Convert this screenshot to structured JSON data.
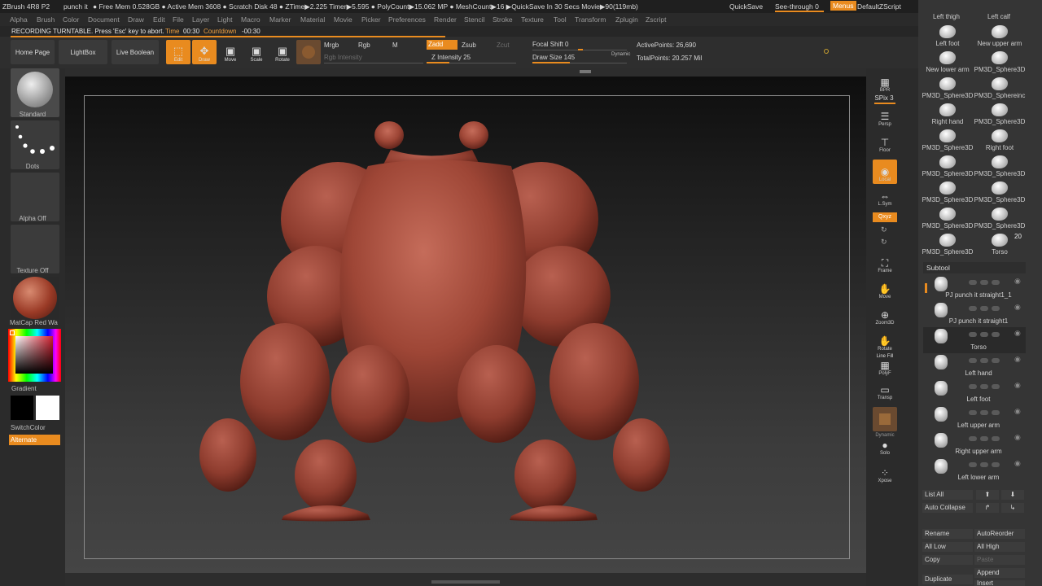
{
  "titlebar": {
    "items": [
      "ZBrush 4R8 P2",
      "punch it",
      "● Free Mem 0.528GB ● Active Mem 3608 ● Scratch Disk 48 ● ZTime▶2.225 Timer▶5.595 ● PolyCount▶15.062 MP ● MeshCount▶16 ▶QuickSave In 30 Secs Movie▶90(119mb)"
    ],
    "quicksave": "QuickSave",
    "seethrough": "See-through  0",
    "menus": "Menus",
    "script": "DefaultZScript"
  },
  "menubar": [
    "Alpha",
    "Brush",
    "Color",
    "Document",
    "Draw",
    "Edit",
    "File",
    "Layer",
    "Light",
    "Macro",
    "Marker",
    "Material",
    "Movie",
    "Picker",
    "Preferences",
    "Render",
    "Stencil",
    "Stroke",
    "Texture",
    "Tool",
    "Transform",
    "Zplugin",
    "Zscript"
  ],
  "recording": {
    "message": "RECORDING TURNTABLE. Press 'Esc' key to abort.",
    "time_label": "Time",
    "time_value": "00:30",
    "countdown_label": "Countdown",
    "countdown_value": "-00:30",
    "progress": 0.52
  },
  "toolbar": {
    "home_page": "Home Page",
    "lightbox": "LightBox",
    "live_boolean": "Live Boolean",
    "edit": "Edit",
    "draw": "Draw",
    "move": "Move",
    "scale": "Scale",
    "rotate": "Rotate",
    "mrgb": "Mrgb",
    "rgb": "Rgb",
    "m": "M",
    "rgb_intensity": "Rgb Intensity",
    "zadd": "Zadd",
    "zsub": "Zsub",
    "zcut": "Zcut",
    "z_intensity": "Z Intensity 25",
    "z_intensity_value": 25,
    "focal_shift": "Focal Shift 0",
    "draw_size": "Draw Size 145",
    "dynamic": "Dynamic",
    "active_points": "ActivePoints: 26,690",
    "total_points": "TotalPoints: 20.257 Mil"
  },
  "leftshelf": {
    "brush": "Standard",
    "stroke": "Dots",
    "alpha": "Alpha Off",
    "texture": "Texture Off",
    "material": "MatCap Red Wa",
    "gradient": "Gradient",
    "switchcolor": "SwitchColor",
    "alternate": "Alternate"
  },
  "rightshelf": {
    "bpr": "BPR",
    "spix": "SPix 3",
    "dynamic": "Dynamic",
    "persp": "Persp",
    "floor": "Floor",
    "local": "Local",
    "lsym": "L.Sym",
    "xyz": "Qxyz",
    "frame": "Frame",
    "move": "Move",
    "zoom3d": "Zoom3D",
    "rotate": "Rotate",
    "linefill": "Line Fill",
    "polyf": "PolyF",
    "transp": "Transp",
    "dynamic2": "Dynamic",
    "solo": "Solo",
    "xpose": "Xpose"
  },
  "tooltray": {
    "top_labels": [
      "Left thigh",
      "Left calf"
    ],
    "grid": [
      "Left foot",
      "New upper arm",
      "New lower arm",
      "PM3D_Sphere3D",
      "PM3D_Sphere3D",
      "PM3D_Sphereinc",
      "Right hand",
      "PM3D_Sphere3D",
      "PM3D_Sphere3D",
      "Right foot",
      "PM3D_Sphere3D",
      "PM3D_Sphere3D",
      "PM3D_Sphere3D",
      "PM3D_Sphere3D",
      "PM3D_Sphere3D",
      "PM3D_Sphere3D",
      "PM3D_Sphere3D",
      "Torso"
    ],
    "count": "20"
  },
  "subtool": {
    "header": "Subtool",
    "items": [
      "PJ punch it straight1_1",
      "PJ punch it straight1",
      "Torso",
      "Left hand",
      "Left foot",
      "Left upper arm",
      "Right upper arm",
      "Left lower arm"
    ],
    "list_all": "List All",
    "auto_collapse": "Auto Collapse",
    "rename": "Rename",
    "auto_reorder": "AutoReorder",
    "all_low": "All Low",
    "all_high": "All High",
    "copy": "Copy",
    "paste": "Paste",
    "append": "Append",
    "duplicate": "Duplicate",
    "insert": "Insert"
  }
}
